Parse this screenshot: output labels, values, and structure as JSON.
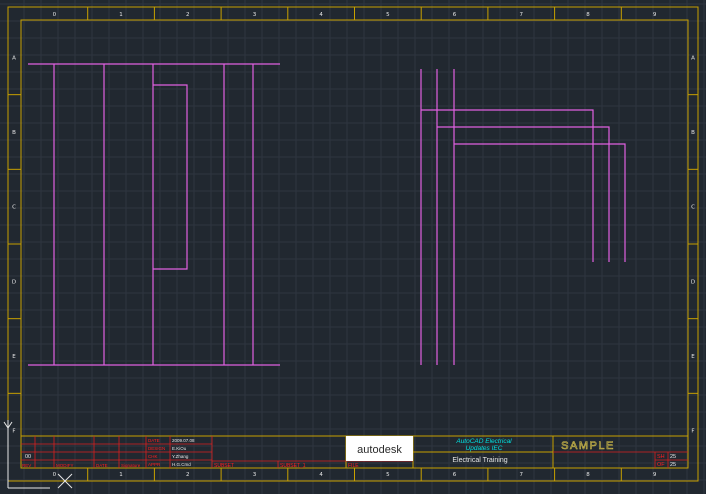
{
  "drawing": {
    "columns": [
      "0",
      "1",
      "2",
      "3",
      "4",
      "5",
      "6",
      "7",
      "8",
      "9"
    ],
    "rows": [
      "A",
      "B",
      "C",
      "D",
      "E",
      "F"
    ]
  },
  "title_block": {
    "rev_headers": [
      "REV",
      "MODIFY",
      "DATE",
      "Signature"
    ],
    "rev_symbol": "00",
    "info_labels": [
      "DATE",
      "DESIGN",
      "CHK",
      "APPR"
    ],
    "info_values": [
      "2009.07.08",
      "E.KiOu",
      "Y.Zhang",
      "H.G.Cmd"
    ],
    "subset_labels": [
      "SUBSET",
      "SUBSET_1",
      "FILE"
    ],
    "logo_text": "autodesk",
    "product_line1": "AutoCAD Electrical",
    "product_line2": "Updates IEC",
    "training_title": "Electrical Training",
    "stamp": "SAMPLE",
    "sheet_labels": [
      "SH",
      "OF"
    ],
    "sheet_values": [
      "25",
      "25"
    ]
  },
  "colors": {
    "background": "#212830",
    "border": "#c8a000",
    "grid": "#2f3842",
    "wire": "#e060e0",
    "red_text": "#ff2020",
    "cyan_text": "#00e0e0",
    "white_text": "#e8e8e8",
    "stamp": "#d8c24a"
  }
}
